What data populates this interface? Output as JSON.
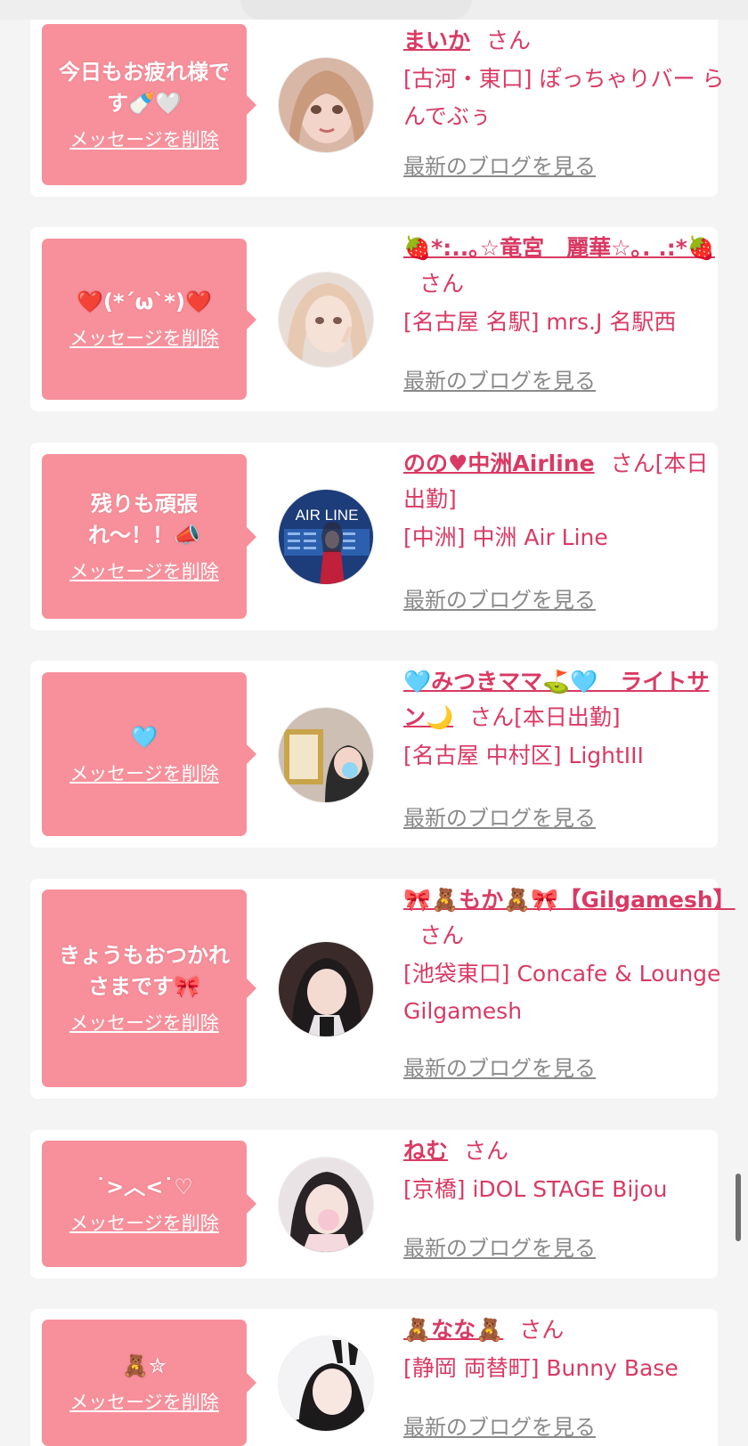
{
  "messages": [
    {
      "bubble_text": "今日もお疲れ様です🍼🤍",
      "delete_label": "メッセージを削除",
      "name": "まいか",
      "honorific": "さん",
      "status": "",
      "shop": "[古河・東口] ぽっちゃりバー らんでぶぅ",
      "blog_label": "最新のブログを見る",
      "avatar_icon": "avatar-photo-1"
    },
    {
      "bubble_text": "❤️(*´ω`*)❤️",
      "delete_label": "メッセージを削除",
      "name": "🍓*:..｡☆竜宮　麗華☆｡. .:*🍓",
      "honorific": "さん",
      "status": "",
      "shop": "[名古屋 名駅] mrs.J 名駅西",
      "blog_label": "最新のブログを見る",
      "avatar_icon": "avatar-photo-2"
    },
    {
      "bubble_text": "残りも頑張れ〜！！📣",
      "delete_label": "メッセージを削除",
      "name": "のの♥中洲Airline",
      "honorific": "さん",
      "status": "[本日出勤]",
      "shop": "[中洲] 中洲 Air Line",
      "blog_label": "最新のブログを見る",
      "avatar_icon": "avatar-photo-3",
      "avatar_text": "AIR LINE"
    },
    {
      "bubble_text": "🩵",
      "delete_label": "メッセージを削除",
      "name": "🩵みつきママ⛳️🩵　ライトサン🌙",
      "honorific": "さん",
      "status": "[本日出勤]",
      "shop": "[名古屋 中村区] LightIII",
      "blog_label": "最新のブログを見る",
      "avatar_icon": "avatar-photo-4"
    },
    {
      "bubble_text": "きょうもおつかれさまです🎀",
      "delete_label": "メッセージを削除",
      "name": "🎀🧸もか🧸🎀【Gilgamesh】",
      "honorific": "さん",
      "status": "",
      "shop": "[池袋東口] Concafe & Lounge Gilgamesh",
      "blog_label": "最新のブログを見る",
      "avatar_icon": "avatar-photo-5"
    },
    {
      "bubble_text": "˙>︿<˙♡",
      "delete_label": "メッセージを削除",
      "name": "ねむ",
      "honorific": "さん",
      "status": "",
      "shop": "[京橋] iDOL STAGE Bijou",
      "blog_label": "最新のブログを見る",
      "avatar_icon": "avatar-photo-6"
    },
    {
      "bubble_text": "🧸✮",
      "delete_label": "メッセージを削除",
      "name": "🧸なな🧸",
      "honorific": "さん",
      "status": "",
      "shop": "[静岡 両替町] Bunny Base",
      "blog_label": "最新のブログを見る",
      "avatar_icon": "avatar-photo-7"
    }
  ],
  "colors": {
    "bubble": "#f7909b",
    "name": "#d93a64",
    "blog_link": "#8a8a8a",
    "background": "#f4f4f4"
  }
}
